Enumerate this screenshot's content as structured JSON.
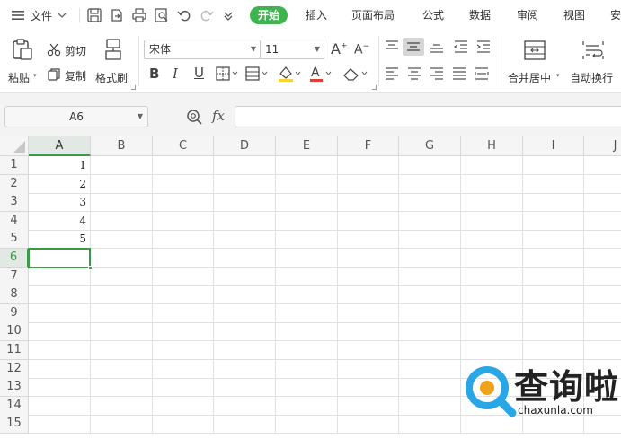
{
  "menubar": {
    "file_label": "文件",
    "tabs": [
      {
        "label": "开始",
        "active": true
      },
      {
        "label": "插入"
      },
      {
        "label": "页面布局"
      },
      {
        "label": "公式"
      },
      {
        "label": "数据"
      },
      {
        "label": "审阅"
      },
      {
        "label": "视图"
      },
      {
        "label": "安"
      }
    ]
  },
  "ribbon": {
    "paste_label": "粘贴",
    "cut_label": "剪切",
    "copy_label": "复制",
    "format_painter_label": "格式刷",
    "font_name": "宋体",
    "font_size": "11",
    "merge_center_label": "合并居中",
    "wrap_text_label": "自动换行",
    "icons": [
      "paste-icon",
      "cut-icon",
      "copy-icon",
      "format-painter-icon",
      "bold-icon",
      "italic-icon",
      "underline-icon",
      "border-icon",
      "fill-color-icon",
      "font-color-icon",
      "clear-icon",
      "align-icons",
      "merge-icon",
      "wrap-icon"
    ],
    "font_color_accent": "#e33e33",
    "fill_color_accent": "#f5d531"
  },
  "formula_bar": {
    "cell_reference": "A6",
    "fx_label": "fx",
    "formula_value": ""
  },
  "grid": {
    "columns": [
      "A",
      "B",
      "C",
      "D",
      "E",
      "F",
      "G",
      "H",
      "I",
      "J"
    ],
    "rows": [
      "1",
      "2",
      "3",
      "4",
      "5",
      "6",
      "7",
      "8",
      "9",
      "10",
      "11",
      "12",
      "13",
      "14",
      "15"
    ],
    "selected_cell": "A6",
    "values": {
      "A1": "1",
      "A2": "2",
      "A3": "3",
      "A4": "4",
      "A5": "5"
    }
  },
  "watermark": {
    "brand": "查询啦",
    "url": "chaxunla.com"
  },
  "colors": {
    "accent": "#3fb34f",
    "selection": "#3a9b47"
  }
}
